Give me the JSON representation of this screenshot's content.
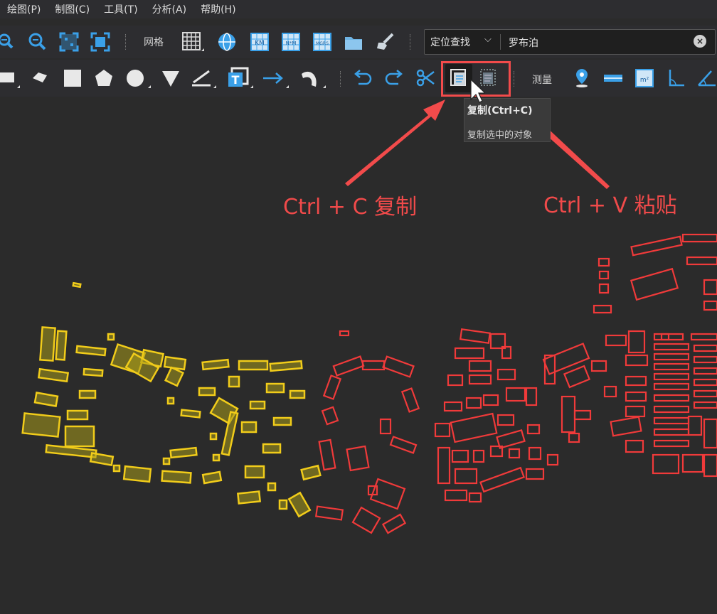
{
  "menu": [
    "绘图(P)",
    "制图(C)",
    "工具(T)",
    "分析(A)",
    "帮助(H)"
  ],
  "toolbar1": {
    "grid_label": "网格",
    "icons": [
      "zoom-in-icon",
      "zoom-out-icon",
      "zoom-extent-icon",
      "full-extent-icon",
      "grid-icon",
      "lnglat-grid-icon",
      "km-grid-icon",
      "nm-grid-icon",
      "mgrs-grid-icon",
      "folder-icon",
      "brush-icon"
    ]
  },
  "search": {
    "mode": "定位查找",
    "value": "罗布泊",
    "clear": "×"
  },
  "toolbar2": {
    "measure_label": "测量",
    "icons": [
      "rectangle-icon",
      "polygon-pin-icon",
      "square-icon",
      "pentagon-icon",
      "circle-icon",
      "triangle-icon",
      "ruler-icon",
      "text-icon",
      "arrow-icon",
      "curve-icon",
      "undo-icon",
      "redo-icon",
      "cut-icon",
      "copy-icon",
      "paste-icon",
      "marker-icon",
      "line-measure-icon",
      "area-measure-icon",
      "angle-icon",
      "angle2-icon"
    ]
  },
  "tooltip": {
    "title": "复制(Ctrl+C)",
    "description": "复制选中的对象"
  },
  "annotations": {
    "copy": "Ctrl + C 复制",
    "paste": "Ctrl + V 粘贴"
  },
  "colors": {
    "accent": "#f24b4b",
    "selected_buildings": "#e6c21a",
    "pasted_buildings": "#f03a3a",
    "icon_blue": "#3aa0e8"
  }
}
